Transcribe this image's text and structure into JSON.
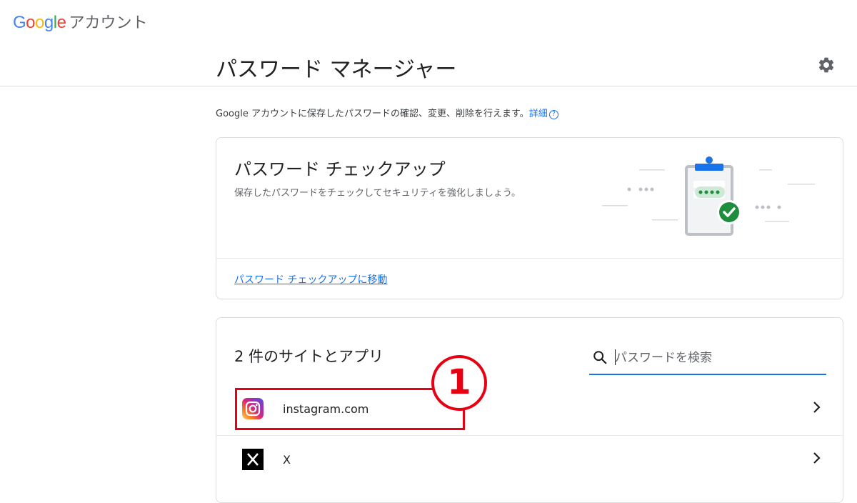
{
  "header": {
    "brand_letters": [
      "G",
      "o",
      "o",
      "g",
      "l",
      "e"
    ],
    "product": "アカウント",
    "title": "パスワード マネージャー"
  },
  "intro": {
    "text": "Google アカウントに保存したパスワードの確認、変更、削除を行えます。",
    "link": "詳細",
    "help_glyph": "?"
  },
  "checkup": {
    "title": "パスワード チェックアップ",
    "description": "保存したパスワードをチェックしてセキュリティを強化しましょう。",
    "link": "パスワード チェックアップに移動"
  },
  "sites": {
    "title": "2 件のサイトとアプリ",
    "search_placeholder": "パスワードを検索",
    "items": [
      {
        "name": "instagram.com",
        "icon": "instagram-icon"
      },
      {
        "name": "X",
        "icon": "x-icon"
      }
    ]
  },
  "annotation": {
    "label": "1"
  },
  "colors": {
    "accent": "#1a73e8",
    "annotation": "#e60012",
    "google_blue": "#4285F4",
    "google_red": "#EA4335",
    "google_yellow": "#FBBC05",
    "google_green": "#34A853"
  }
}
